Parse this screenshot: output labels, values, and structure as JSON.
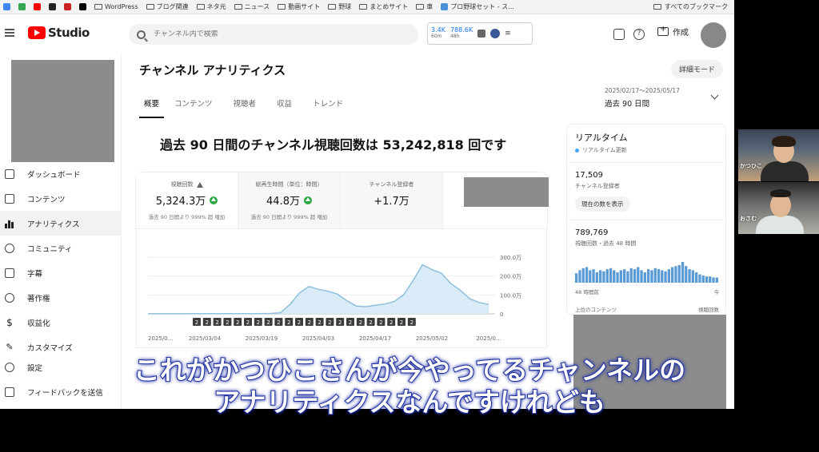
{
  "bookmarks": {
    "items": [
      "WordPress",
      "ブログ関連",
      "ネタ元",
      "ニュース",
      "動画サイト",
      "野球",
      "まとめサイト",
      "車",
      "プロ野球セット - ス..."
    ],
    "all_bookmarks": "すべてのブックマーク"
  },
  "header": {
    "logo_text": "Studio",
    "search_placeholder": "チャンネル内で検索",
    "ext_stat1_value": "3.4K",
    "ext_stat1_sub": "60m",
    "ext_stat2_value": "788.6K",
    "ext_stat2_sub": "48h",
    "create_label": "作成"
  },
  "sidebar": {
    "items": [
      {
        "label": "ダッシュボード",
        "icon": "dashboard-icon"
      },
      {
        "label": "コンテンツ",
        "icon": "content-icon"
      },
      {
        "label": "アナリティクス",
        "icon": "analytics-icon"
      },
      {
        "label": "コミュニティ",
        "icon": "community-icon"
      },
      {
        "label": "字幕",
        "icon": "subtitles-icon"
      },
      {
        "label": "著作権",
        "icon": "copyright-icon"
      },
      {
        "label": "収益化",
        "icon": "monetization-icon"
      },
      {
        "label": "カスタマイズ",
        "icon": "customize-icon"
      }
    ],
    "bottom": [
      {
        "label": "設定",
        "icon": "settings-icon"
      },
      {
        "label": "フィードバックを送信",
        "icon": "feedback-icon"
      }
    ]
  },
  "main": {
    "title": "チャンネル アナリティクス",
    "detail_mode": "詳細モード",
    "tabs": [
      "概要",
      "コンテンツ",
      "視聴者",
      "収益",
      "トレンド"
    ],
    "date_sub": "2025/02/17～2025/05/17",
    "date_main": "過去 90 日間",
    "headline": "過去 90 日間のチャンネル視聴回数は 53,242,818 回です",
    "metrics": [
      {
        "label": "視聴回数",
        "value": "5,324.3万",
        "sub": "過去 90 日間より 999% 超 増加"
      },
      {
        "label": "総再生時間（単位：時間）",
        "value": "44.8万",
        "sub": "過去 90 日間より 999% 超 増加"
      },
      {
        "label": "チャンネル登録者",
        "value": "+1.7万",
        "sub": ""
      }
    ]
  },
  "chart_data": {
    "type": "area",
    "x_labels": [
      "2025/0...",
      "2025/03/04",
      "2025/03/19",
      "2025/04/03",
      "2025/04/17",
      "2025/05/02",
      "2025/0..."
    ],
    "y_ticks": [
      "300.0万",
      "200.0万",
      "100.0万",
      "0"
    ],
    "ylim": [
      0,
      3000000
    ],
    "values": [
      5000,
      5000,
      5000,
      6000,
      6000,
      7000,
      7000,
      8000,
      8000,
      9000,
      10000,
      12000,
      15000,
      20000,
      60000,
      500000,
      1100000,
      1450000,
      1300000,
      1200000,
      1050000,
      700000,
      420000,
      380000,
      450000,
      520000,
      650000,
      1000000,
      1750000,
      2600000,
      2350000,
      2150000,
      1600000,
      1250000,
      800000,
      600000,
      500000
    ],
    "marker_count": 22,
    "marker_label": "2",
    "color": "#8dbfde"
  },
  "realtime": {
    "title": "リアルタイム",
    "sub": "リアルタイム更新",
    "subscribers_value": "17,509",
    "subscribers_label": "チャンネル登録者",
    "show_current": "現在の数を表示",
    "views_value": "789,769",
    "views_label": "視聴回数・過去 48 時間",
    "axis_left": "48 時間前",
    "axis_right": "今",
    "top_content": "上位のコンテンツ",
    "top_views": "視聴回数",
    "bar_values": [
      9,
      12,
      14,
      15,
      12,
      13,
      10,
      12,
      11,
      13,
      14,
      12,
      10,
      12,
      13,
      11,
      14,
      13,
      15,
      12,
      10,
      13,
      12,
      14,
      13,
      12,
      11,
      13,
      15,
      16,
      17,
      20,
      16,
      13,
      12,
      10,
      8,
      7,
      6,
      6,
      5,
      5
    ]
  },
  "video_call": {
    "name1": "かつひこ",
    "name2": "おさむ"
  },
  "subtitle": {
    "line1": "これがかつひこさんが今やってるチャンネルの",
    "line2": "アナリティクスなんですけれども"
  }
}
